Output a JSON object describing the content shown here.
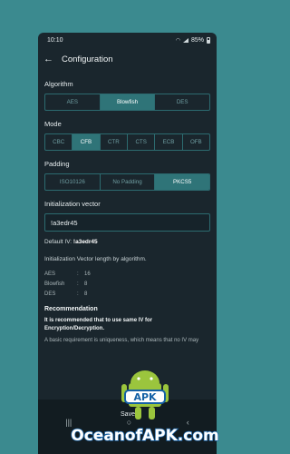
{
  "status": {
    "time": "10:10",
    "battery": "85%"
  },
  "appbar": {
    "title": "Configuration"
  },
  "algorithm": {
    "label": "Algorithm",
    "options": [
      "AES",
      "Blowfish",
      "DES"
    ],
    "selected": "Blowfish"
  },
  "mode": {
    "label": "Mode",
    "options": [
      "CBC",
      "CFB",
      "CTR",
      "CTS",
      "ECB",
      "OFB"
    ],
    "selected": "CFB"
  },
  "padding": {
    "label": "Padding",
    "options": [
      "ISO10126",
      "No Padding",
      "PKCS5"
    ],
    "selected": "PKCS5"
  },
  "iv": {
    "label": "Initialization vector",
    "value": "!a3edr45",
    "default_prefix": "Default IV: ",
    "default_value": "!a3edr45"
  },
  "iv_length": {
    "title": "Initialization Vector length by algorithm.",
    "rows": [
      {
        "alg": "AES",
        "sep": ":",
        "val": "16"
      },
      {
        "alg": "Blowfish",
        "sep": ":",
        "val": "8"
      },
      {
        "alg": "DES",
        "sep": ":",
        "val": "8"
      }
    ]
  },
  "recommendation": {
    "title": "Recommendation",
    "text": "It is recommended that to use same IV for Encryption/Decryption.",
    "sub": "A basic requirement is uniqueness, which means that no IV may"
  },
  "save_label": "Save",
  "watermark": {
    "text": "OceanofAPK.com",
    "badge": "APK"
  },
  "colors": {
    "accent": "#2f7478",
    "background": "#1a262d",
    "outer": "#3b8a8f"
  }
}
